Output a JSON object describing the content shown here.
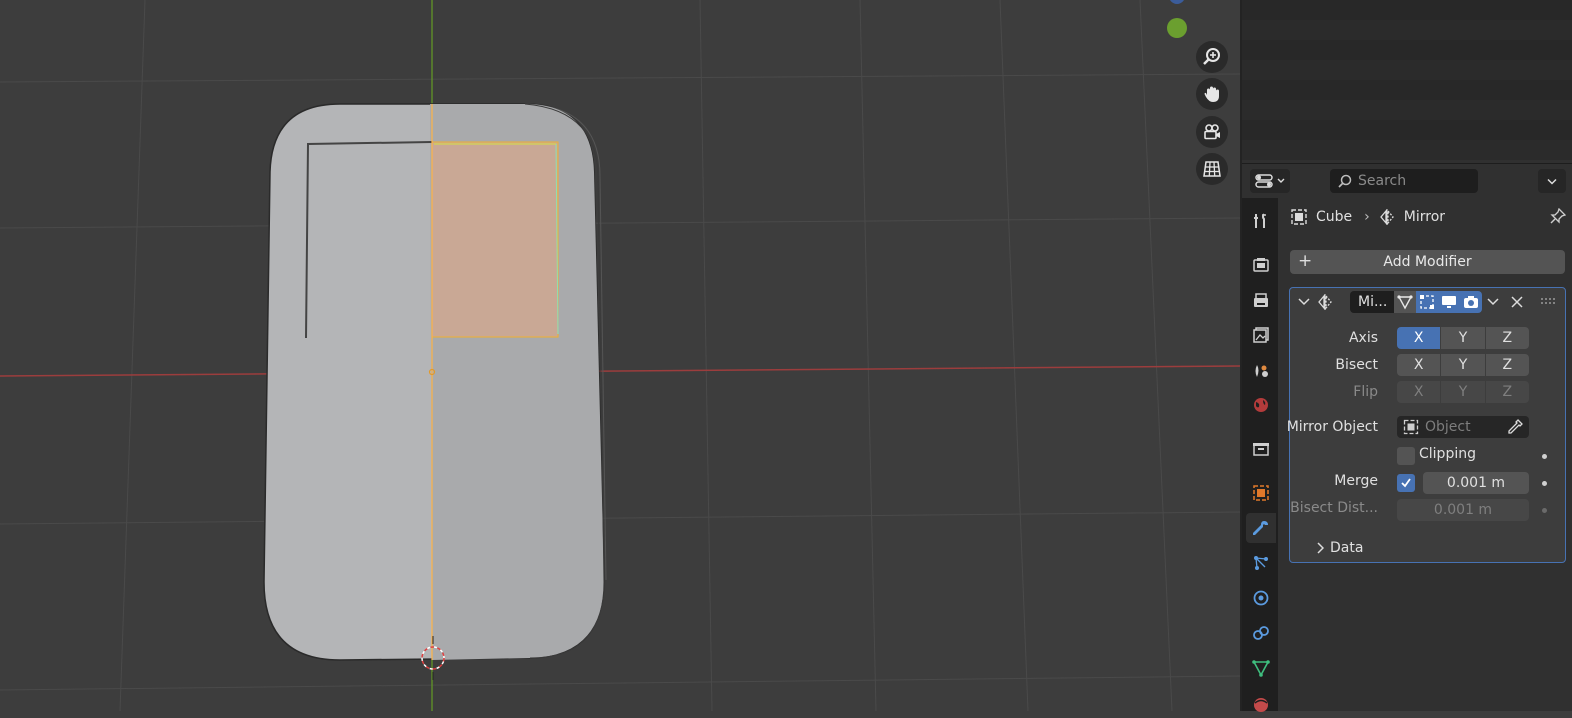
{
  "viewport": {
    "nav_buttons": [
      "zoom-icon",
      "pan-hand-icon",
      "camera-view-icon",
      "ortho-grid-icon"
    ],
    "colors": {
      "background": "#3d3d3d",
      "x_axis": "#9c3d3d",
      "y_axis": "#5d8a2a",
      "mesh": "#b4b5b7",
      "selection": "#ffb347",
      "selected_face": "#c9a895"
    }
  },
  "properties": {
    "search_placeholder": "Search",
    "breadcrumb": {
      "object": "Cube",
      "modifier": "Mirror"
    },
    "add_modifier_label": "Add Modifier",
    "tabs": [
      "tool-icon",
      "render-icon",
      "output-icon",
      "view-layer-icon",
      "scene-icon",
      "world-icon",
      "collection-icon",
      "object-icon",
      "modifier-icon",
      "particles-icon",
      "physics-icon",
      "constraints-icon",
      "data-icon",
      "material-icon"
    ],
    "active_tab": "modifier-icon",
    "modifier": {
      "name": "Mi...",
      "axis": {
        "label": "Axis",
        "values": [
          "X",
          "Y",
          "Z"
        ],
        "active": [
          "X"
        ]
      },
      "bisect": {
        "label": "Bisect",
        "values": [
          "X",
          "Y",
          "Z"
        ],
        "active": []
      },
      "flip": {
        "label": "Flip",
        "values": [
          "X",
          "Y",
          "Z"
        ],
        "active": []
      },
      "mirror_object": {
        "label": "Mirror Object",
        "placeholder": "Object"
      },
      "clipping": {
        "label": "Clipping",
        "checked": false
      },
      "merge": {
        "label": "Merge",
        "checked": true,
        "value": "0.001 m"
      },
      "bisect_distance": {
        "label": "Bisect Dist...",
        "value": "0.001 m"
      },
      "data_panel": {
        "label": "Data"
      }
    },
    "colors": {
      "accent": "#4772b3",
      "panel": "#303030",
      "button": "#545454"
    }
  }
}
